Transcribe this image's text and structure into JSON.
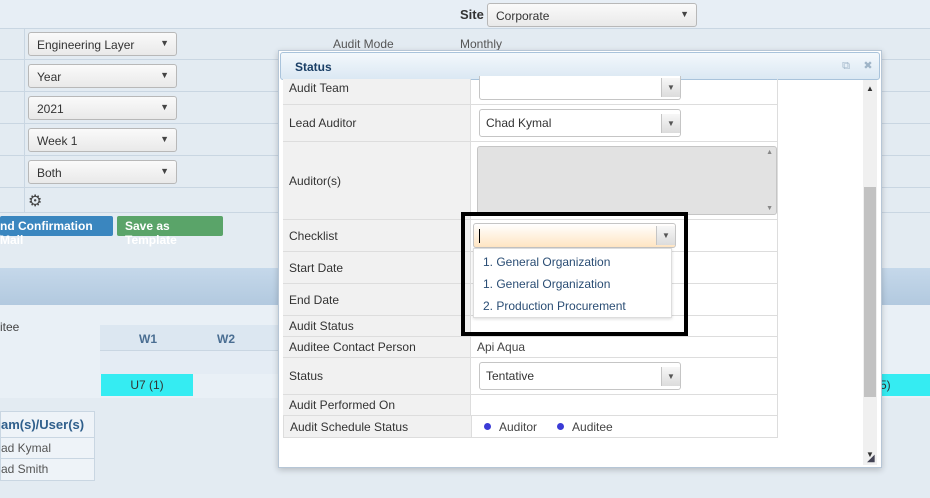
{
  "bg": {
    "site_label": "Site",
    "site_value": "Corporate",
    "layer_value": "Engineering Layer",
    "period_value": "Year",
    "year_value": "2021",
    "week_value": "Week 1",
    "both_value": "Both",
    "audit_mode_label": "Audit Mode",
    "audit_mode_value": "Monthly",
    "confirm_btn": "nd Confirmation Mail",
    "template_btn": "Save as Template",
    "col_itee": "itee",
    "col_w1": "W1",
    "col_w2": "W2",
    "cell_u7": "U7 (1)",
    "cell_5": "5)",
    "panel_title": "am(s)/User(s)",
    "panel_users": [
      "ad Kymal",
      "ad Smith"
    ]
  },
  "modal": {
    "title": "Status",
    "rows": {
      "audit_team": "Audit Team",
      "lead_auditor": "Lead Auditor",
      "lead_auditor_value": "Chad Kymal",
      "auditors": "Auditor(s)",
      "checklist": "Checklist",
      "start_date": "Start Date",
      "end_date": "End Date",
      "audit_status": "Audit Status",
      "auditee_contact": "Auditee Contact Person",
      "auditee_contact_value": "Api Aqua",
      "status": "Status",
      "status_value": "Tentative",
      "audit_performed_on": "Audit Performed On",
      "audit_schedule_status": "Audit Schedule Status",
      "legend_auditor": "Auditor",
      "legend_auditee": "Auditee"
    },
    "checklist_options": [
      "1. General Organization",
      "1. General Organization",
      "2. Production Procurement"
    ]
  },
  "colors": {
    "accent_green": "#5aa469",
    "accent_blue": "#3a86bf",
    "highlight_cyan": "#35ecf2"
  }
}
